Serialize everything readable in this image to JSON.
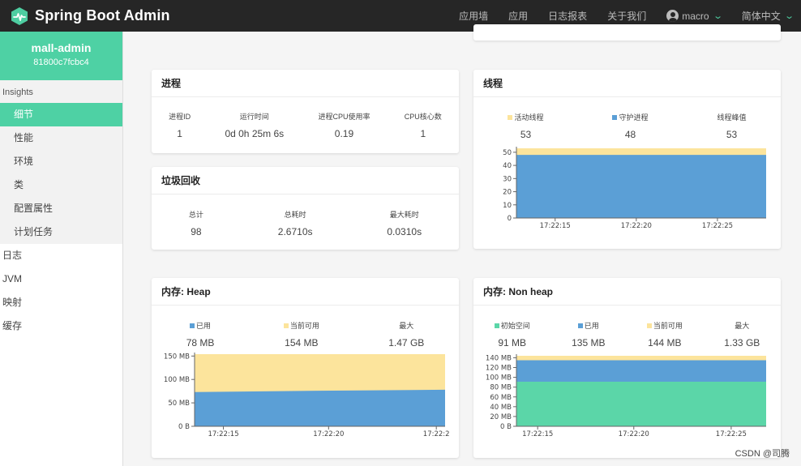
{
  "topbar": {
    "title": "Spring Boot Admin",
    "nav": [
      "应用墙",
      "应用",
      "日志报表",
      "关于我们"
    ],
    "user": "macro",
    "language": "简体中文",
    "accent_color": "#4ecda1"
  },
  "sidebar": {
    "app_name": "mall-admin",
    "app_id": "81800c7fcbc4",
    "group_title": "Insights",
    "group_items": [
      "细节",
      "性能",
      "环境",
      "类",
      "配置属性",
      "计划任务"
    ],
    "active_item": "细节",
    "items": [
      "日志",
      "JVM",
      "映射",
      "缓存"
    ]
  },
  "process": {
    "title": "进程",
    "stats": [
      {
        "label": "进程ID",
        "value": "1"
      },
      {
        "label": "运行时间",
        "value": "0d 0h 25m 6s"
      },
      {
        "label": "进程CPU使用率",
        "value": "0.19"
      },
      {
        "label": "CPU核心数",
        "value": "1"
      }
    ]
  },
  "gc": {
    "title": "垃圾回收",
    "stats": [
      {
        "label": "总计",
        "value": "98"
      },
      {
        "label": "总耗时",
        "value": "2.6710s"
      },
      {
        "label": "最大耗时",
        "value": "0.0310s"
      }
    ]
  },
  "threads": {
    "title": "线程",
    "stats": [
      {
        "label": "活动线程",
        "value": "53",
        "color": "#fce49c"
      },
      {
        "label": "守护进程",
        "value": "48",
        "color": "#5b9fd6"
      },
      {
        "label": "线程峰值",
        "value": "53"
      }
    ]
  },
  "heap": {
    "title": "内存: Heap",
    "stats": [
      {
        "label": "已用",
        "value": "78 MB",
        "color": "#5b9fd6"
      },
      {
        "label": "当前可用",
        "value": "154 MB",
        "color": "#fce49c"
      },
      {
        "label": "最大",
        "value": "1.47 GB"
      }
    ]
  },
  "nonheap": {
    "title": "内存: Non heap",
    "stats": [
      {
        "label": "初始空间",
        "value": "91 MB",
        "color": "#5bd6a8"
      },
      {
        "label": "已用",
        "value": "135 MB",
        "color": "#5b9fd6"
      },
      {
        "label": "当前可用",
        "value": "144 MB",
        "color": "#fce49c"
      },
      {
        "label": "最大",
        "value": "1.33 GB"
      }
    ]
  },
  "chart_data": [
    {
      "type": "area",
      "name": "threads",
      "x": [
        "17:22:15",
        "17:22:20",
        "17:22:25"
      ],
      "ylim": [
        0,
        53
      ],
      "yticks": [
        "0",
        "10",
        "20",
        "30",
        "40",
        "50"
      ],
      "series": [
        {
          "name": "守护进程",
          "values": [
            48,
            48,
            48
          ],
          "color": "#5b9fd6"
        },
        {
          "name": "活动线程",
          "values": [
            53,
            53,
            53
          ],
          "color": "#fce49c"
        }
      ]
    },
    {
      "type": "area",
      "name": "heap",
      "x": [
        "17:22:15",
        "17:22:20",
        "17:22:2"
      ],
      "ylim": [
        0,
        154
      ],
      "yticks": [
        "0 B",
        "50 MB",
        "100 MB",
        "150 MB"
      ],
      "series": [
        {
          "name": "已用",
          "values": [
            73,
            76,
            78
          ],
          "color": "#5b9fd6"
        },
        {
          "name": "当前可用",
          "values": [
            154,
            154,
            154
          ],
          "color": "#fce49c"
        }
      ]
    },
    {
      "type": "area",
      "name": "nonheap",
      "x": [
        "17:22:15",
        "17:22:20",
        "17:22:25"
      ],
      "ylim": [
        0,
        144
      ],
      "yticks": [
        "0 B",
        "20 MB",
        "40 MB",
        "60 MB",
        "80 MB",
        "100 MB",
        "120 MB",
        "140 MB"
      ],
      "series": [
        {
          "name": "初始空间",
          "values": [
            91,
            91,
            91
          ],
          "color": "#5bd6a8"
        },
        {
          "name": "已用",
          "values": [
            135,
            135,
            135
          ],
          "color": "#5b9fd6"
        },
        {
          "name": "当前可用",
          "values": [
            144,
            144,
            144
          ],
          "color": "#fce49c"
        }
      ]
    }
  ],
  "watermark": "CSDN @司腾"
}
